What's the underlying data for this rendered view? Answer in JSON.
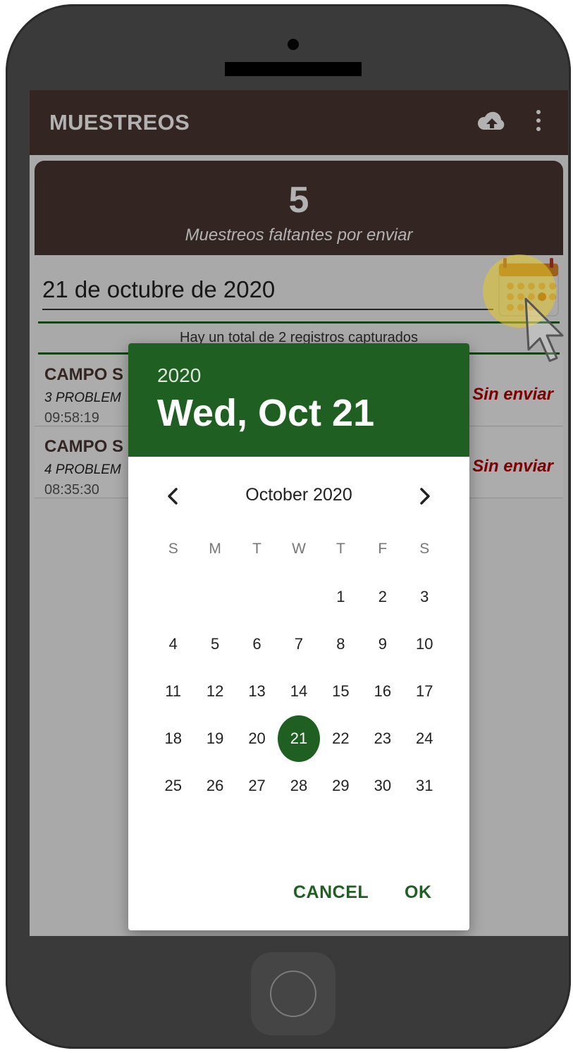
{
  "app": {
    "title": "MUESTREOS",
    "icons": {
      "upload": "cloud-upload-icon",
      "more": "more-vert-icon",
      "calendar": "calendar-icon",
      "pointer": "tap-pointer-icon"
    }
  },
  "summary": {
    "count": "5",
    "label": "Muestreos faltantes por enviar"
  },
  "date_field": {
    "value": "21 de octubre de 2020"
  },
  "records_total": "Hay un total de 2 registros capturados",
  "records": [
    {
      "title": "CAMPO S",
      "subtitle": "3 PROBLEM",
      "time": "09:58:19",
      "status": "Sin enviar"
    },
    {
      "title": "CAMPO S",
      "subtitle": "4 PROBLEM",
      "time": "08:35:30",
      "status": "Sin enviar"
    }
  ],
  "date_picker": {
    "year": "2020",
    "selected_date": "Wed, Oct 21",
    "month_label": "October 2020",
    "weekdays": [
      "S",
      "M",
      "T",
      "W",
      "T",
      "F",
      "S"
    ],
    "leading_blank_days": 4,
    "days_in_month": 31,
    "selected_day": 21,
    "cancel_label": "CANCEL",
    "ok_label": "OK"
  },
  "colors": {
    "appbar": "#4a3530",
    "accent_green": "#1f5f22",
    "status_red": "#b00000",
    "highlight": "#e6c828"
  }
}
